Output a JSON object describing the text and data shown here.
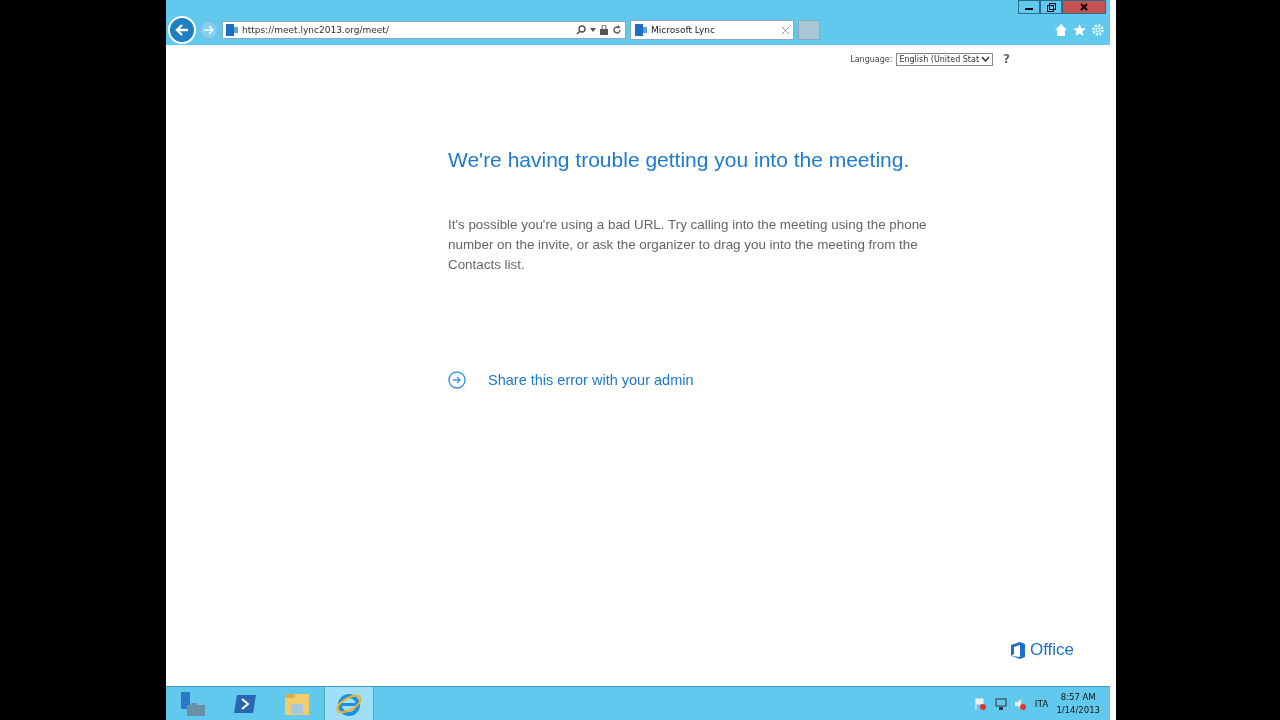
{
  "browser": {
    "address": "https://meet.lync2013.org/meet/",
    "tabs": [
      {
        "title": "Microsoft Lync",
        "selected": true
      }
    ]
  },
  "language": {
    "label": "Language:",
    "value": "English (United Stat",
    "help": "?"
  },
  "error": {
    "title": "We're having trouble getting you into the meeting.",
    "body": "It's possible you're using a bad URL. Try calling into the meeting using the phone number on the invite, or ask the organizer to drag you into the meeting from the Contacts list.",
    "link": "Share this error with your admin"
  },
  "brand": "Office",
  "taskbar": {
    "apps": [
      {
        "kind": "server",
        "selected": false
      },
      {
        "kind": "shell",
        "selected": false
      },
      {
        "kind": "folder",
        "selected": false
      },
      {
        "kind": "browser",
        "selected": true
      }
    ],
    "language": "ITA",
    "time": "8:57 AM",
    "date": "1/14/2013"
  }
}
